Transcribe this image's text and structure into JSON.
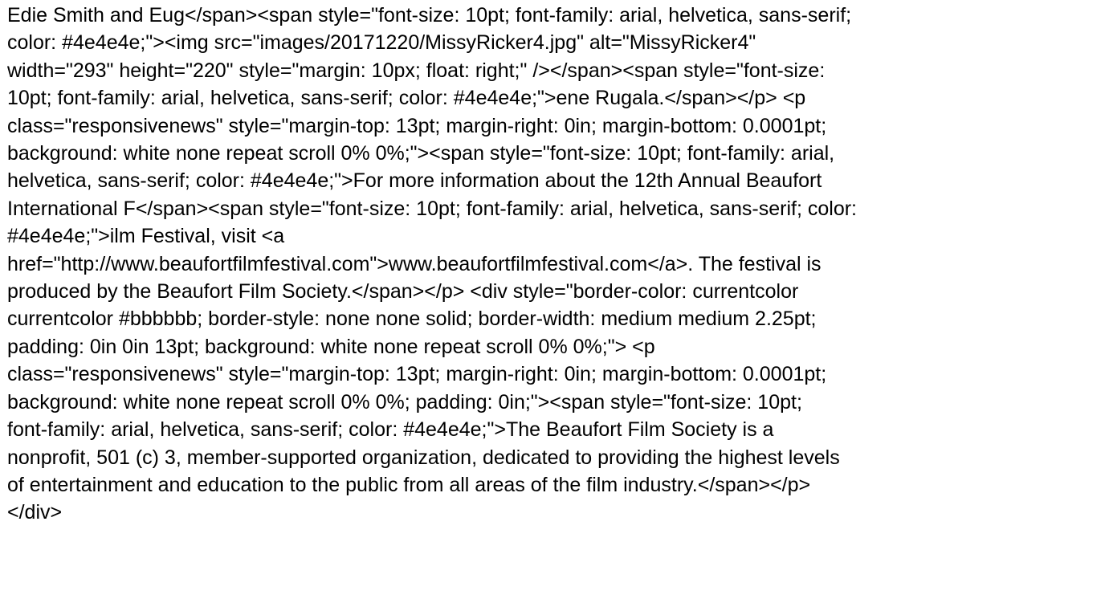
{
  "document": {
    "lines": [
      "Edie Smith and Eug</span><span style=\"font-size: 10pt; font-family: arial, helvetica, sans-serif;",
      "color: #4e4e4e;\"><img src=\"images/20171220/MissyRicker4.jpg\" alt=\"MissyRicker4\"",
      "width=\"293\" height=\"220\" style=\"margin: 10px; float: right;\" /></span><span style=\"font-size:",
      "10pt; font-family: arial, helvetica, sans-serif; color: #4e4e4e;\">ene Rugala.</span></p>  <p",
      "class=\"responsivenews\" style=\"margin-top: 13pt; margin-right: 0in; margin-bottom: 0.0001pt;",
      "background: white none repeat scroll 0% 0%;\"><span style=\"font-size: 10pt; font-family: arial,",
      "helvetica, sans-serif; color: #4e4e4e;\">For more information about the 12th Annual Beaufort",
      "International F</span><span style=\"font-size: 10pt; font-family: arial, helvetica, sans-serif; color:",
      "#4e4e4e;\">ilm Festival, visit <a",
      "href=\"http://www.beaufortfilmfestival.com\">www.beaufortfilmfestival.com</a>. The festival is",
      "produced by the Beaufort Film Society.</span></p>  <div style=\"border-color: currentcolor",
      "currentcolor #bbbbbb; border-style: none none solid; border-width: medium medium 2.25pt;",
      "padding: 0in 0in 13pt; background: white none repeat scroll 0% 0%;\">  <p",
      "class=\"responsivenews\" style=\"margin-top: 13pt; margin-right: 0in; margin-bottom: 0.0001pt;",
      "background: white none repeat scroll 0% 0%; padding: 0in;\"><span style=\"font-size: 10pt;",
      "font-family: arial, helvetica, sans-serif; color: #4e4e4e;\">The Beaufort Film Society is a",
      "nonprofit, 501 (c) 3, member-supported organization, dedicated to providing the highest levels",
      "of entertainment and education to the public from all areas of the film industry.</span></p>",
      "</div>"
    ]
  },
  "colors": {
    "text": "#000000",
    "background": "#ffffff"
  }
}
